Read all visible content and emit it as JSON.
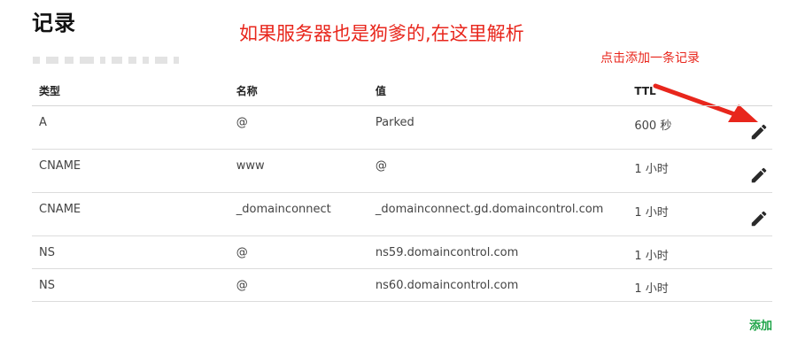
{
  "section_title": "记录",
  "annotations": {
    "main": "如果服务器也是狗爹的,在这里解析",
    "hint": "点击添加一条记录"
  },
  "table": {
    "headers": {
      "type": "类型",
      "name": "名称",
      "value": "值",
      "ttl": "TTL"
    },
    "rows": [
      {
        "type": "A",
        "name": "@",
        "value": "Parked",
        "ttl": "600 秒",
        "editable": true
      },
      {
        "type": "CNAME",
        "name": "www",
        "value": "@",
        "ttl": "1 小时",
        "editable": true
      },
      {
        "type": "CNAME",
        "name": "_domainconnect",
        "value": "_domainconnect.gd.domaincontrol.com",
        "ttl": "1 小时",
        "editable": true
      },
      {
        "type": "NS",
        "name": "@",
        "value": "ns59.domaincontrol.com",
        "ttl": "1 小时",
        "editable": false
      },
      {
        "type": "NS",
        "name": "@",
        "value": "ns60.domaincontrol.com",
        "ttl": "1 小时",
        "editable": false
      }
    ]
  },
  "add_label": "添加",
  "colors": {
    "annotation": "#e8261c",
    "add": "#1ea448",
    "text": "#444444"
  },
  "icons": {
    "edit": "pencil-icon",
    "arrow": "red-arrow-annotation"
  }
}
